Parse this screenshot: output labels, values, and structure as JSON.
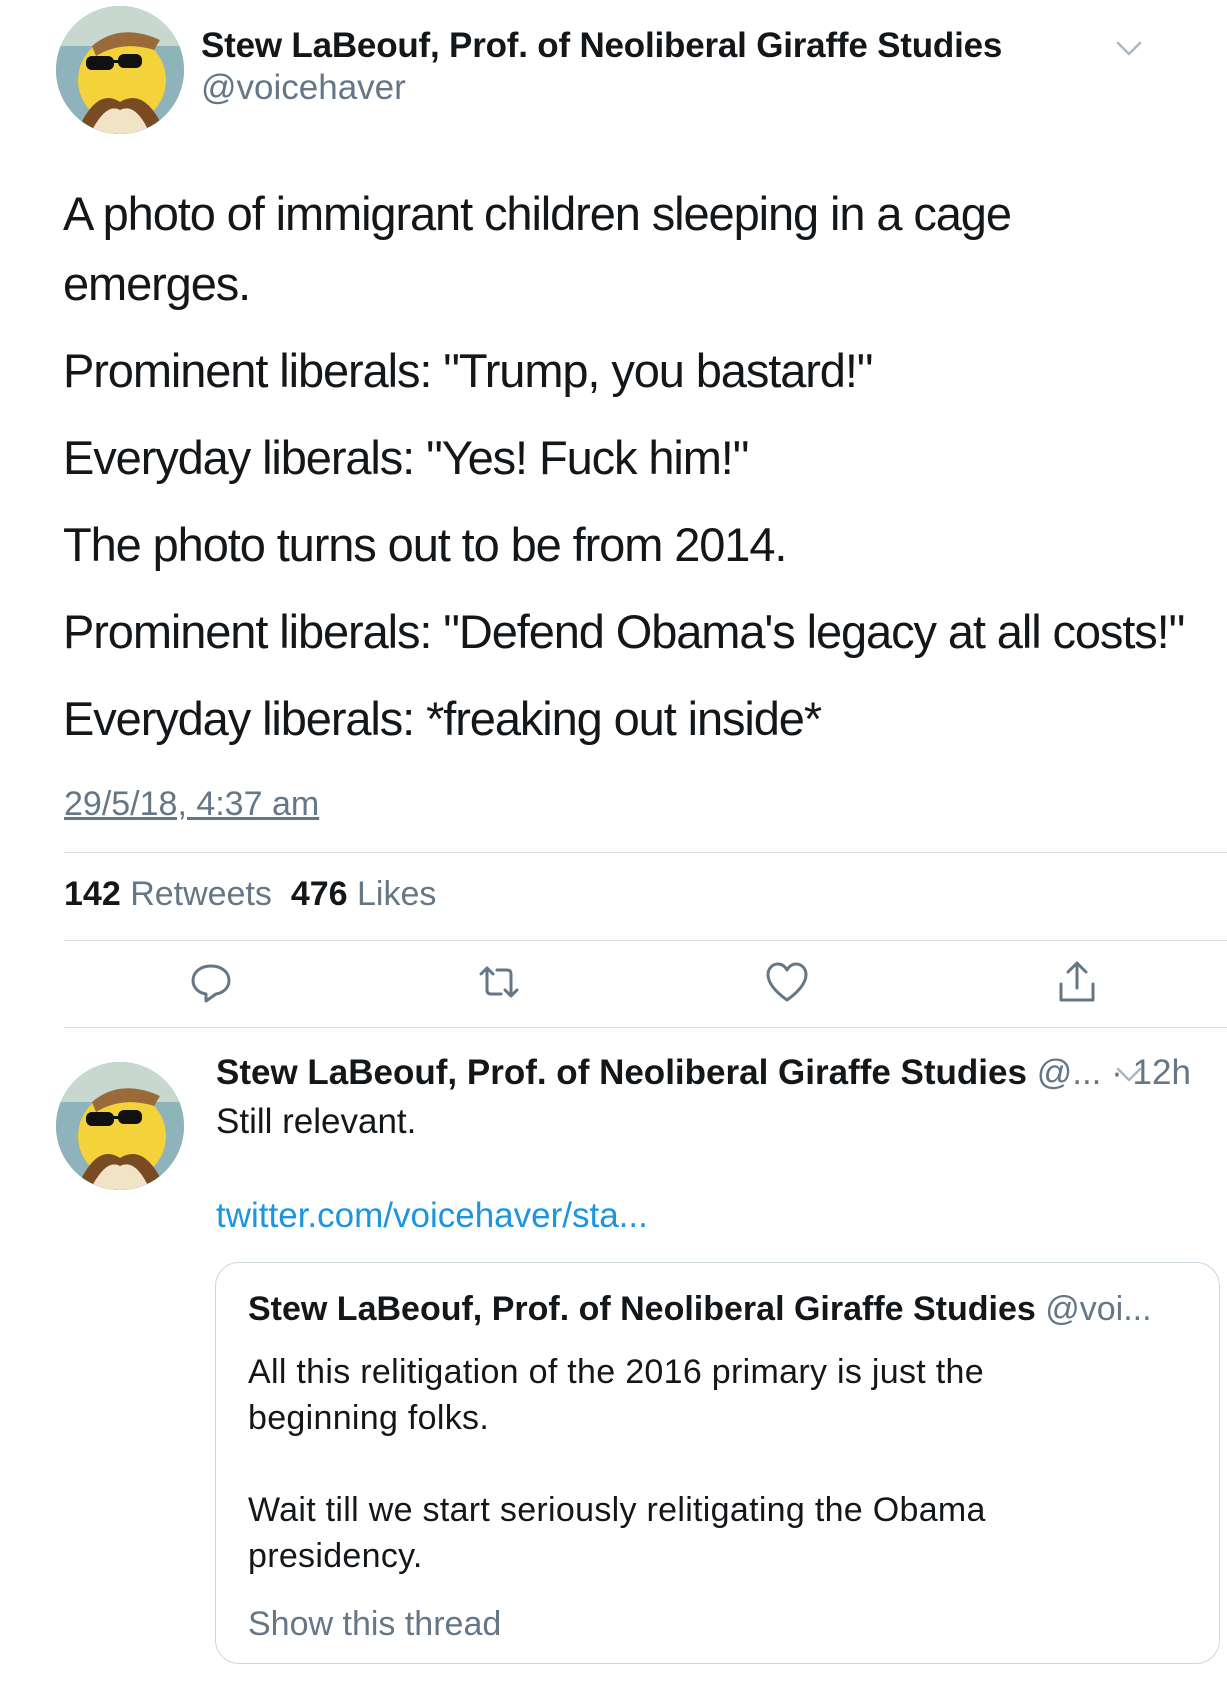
{
  "main_tweet": {
    "author_name": "Stew LaBeouf, Prof. of Neoliberal Giraffe Studies",
    "handle": "@voicehaver",
    "lines": [
      "A photo of immigrant children sleeping in a cage",
      "emerges.",
      "Prominent liberals: \"Trump, you bastard!\"",
      "Everyday liberals: \"Yes! Fuck him!\"",
      "The photo turns out to be from 2014.",
      "Prominent liberals: \"Defend Obama's legacy at all costs!\"",
      "Everyday liberals: *freaking out inside*"
    ],
    "timestamp": "29/5/18, 4:37 am",
    "retweets_count": "142",
    "retweets_label": "Retweets",
    "likes_count": "476",
    "likes_label": "Likes"
  },
  "actions": {
    "reply_icon": "reply-icon",
    "retweet_icon": "retweet-icon",
    "like_icon": "heart-icon",
    "share_icon": "share-icon"
  },
  "reply_tweet": {
    "author_name": "Stew LaBeouf, Prof. of Neoliberal Giraffe Studies",
    "handle_truncated": "@...",
    "age": "· 12h",
    "text": "Still relevant.",
    "link": "twitter.com/voicehaver/sta...",
    "quoted": {
      "author_name": "Stew LaBeouf, Prof. of Neoliberal Giraffe Studies",
      "handle_truncated": "@voi...",
      "lines": [
        "All this relitigation of the 2016 primary is just the",
        "beginning folks.",
        "Wait till we start seriously relitigating the Obama",
        "presidency."
      ],
      "show_thread": "Show this thread"
    }
  },
  "colors": {
    "text": "#14171a",
    "secondary": "#657786",
    "link": "#1b95e0",
    "divider": "#d7dde2"
  }
}
